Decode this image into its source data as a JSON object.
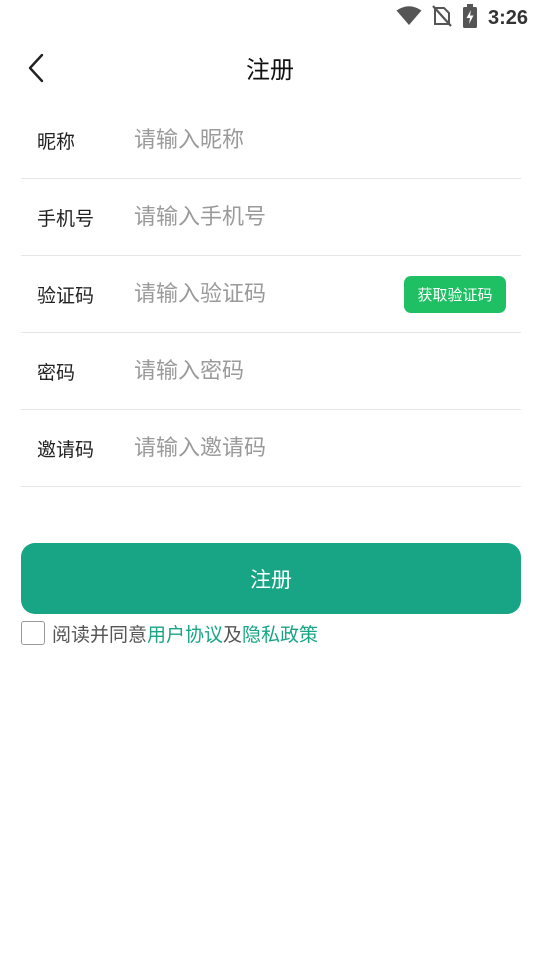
{
  "status_bar": {
    "time": "3:26",
    "icons": [
      "wifi-icon",
      "no-sim-icon",
      "battery-charging-icon"
    ]
  },
  "header": {
    "title": "注册",
    "back_icon": "chevron-left-icon"
  },
  "form": {
    "nickname": {
      "label": "昵称",
      "placeholder": "请输入昵称",
      "value": ""
    },
    "phone": {
      "label": "手机号",
      "placeholder": "请输入手机号",
      "value": ""
    },
    "code": {
      "label": "验证码",
      "placeholder": "请输入验证码",
      "value": "",
      "button_label": "获取验证码"
    },
    "password": {
      "label": "密码",
      "placeholder": "请输入密码",
      "value": ""
    },
    "invite": {
      "label": "邀请码",
      "placeholder": "请输入邀请码",
      "value": ""
    }
  },
  "submit": {
    "label": "注册"
  },
  "agreement": {
    "checked": false,
    "prefix": "阅读并同意",
    "user_agreement": "用户协议",
    "conjunction": "及",
    "privacy_policy": "隐私政策"
  },
  "colors": {
    "primary": "#17a585",
    "code_button": "#1ec063",
    "divider": "#e6e6e6",
    "placeholder": "#9a9a9a"
  }
}
